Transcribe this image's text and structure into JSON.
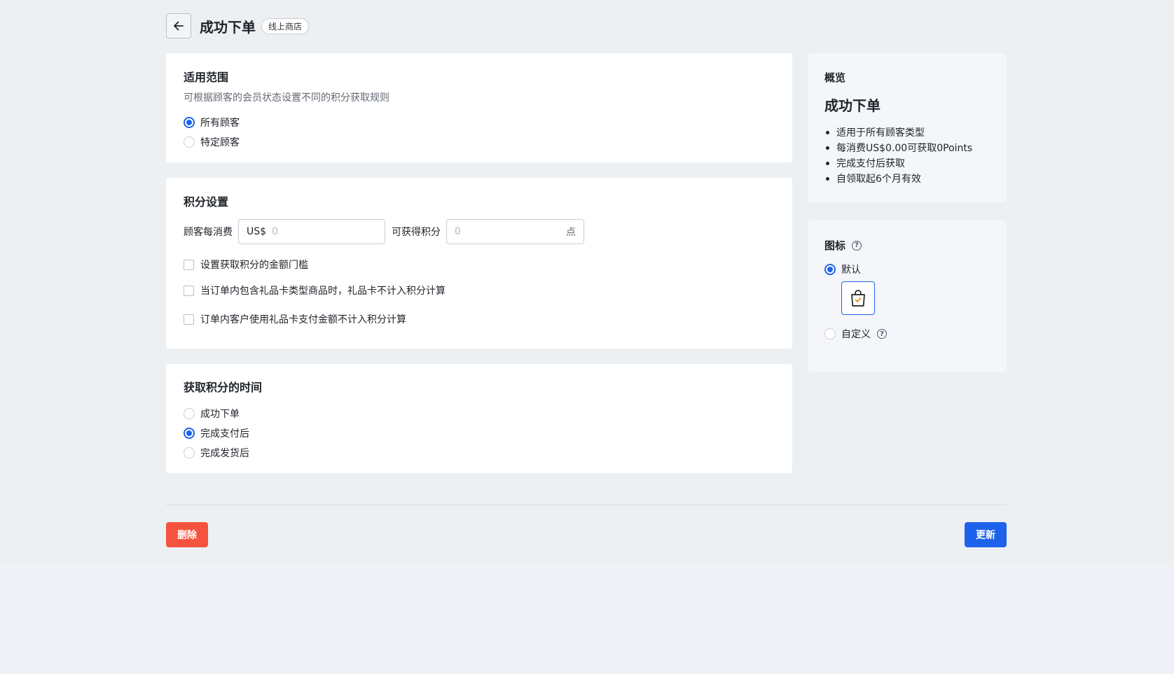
{
  "header": {
    "title": "成功下单",
    "tag": "线上商店"
  },
  "scope": {
    "title": "适用范围",
    "desc": "可根据顾客的会员状态设置不同的积分获取规则",
    "options": [
      "所有顾客",
      "特定顾客"
    ],
    "selected": 0
  },
  "points": {
    "title": "积分设置",
    "spend_label": "顾客每消费",
    "currency_prefix": "US$",
    "spend_placeholder": "0",
    "earn_label": "可获得积分",
    "earn_placeholder": "0",
    "earn_suffix": "点",
    "checks": [
      "设置获取积分的金额门槛",
      "当订单内包含礼品卡类型商品时，礼品卡不计入积分计算",
      "订单内客户使用礼品卡支付金额不计入积分计算"
    ]
  },
  "timing": {
    "title": "获取积分的时间",
    "options": [
      "成功下单",
      "完成支付后",
      "完成发货后"
    ],
    "selected": 1
  },
  "overview": {
    "title": "概览",
    "name": "成功下单",
    "items": [
      "适用于所有顾客类型",
      "每消费US$0.00可获取0Points",
      "完成支付后获取",
      "自领取起6个月有效"
    ]
  },
  "icon_section": {
    "title": "图标",
    "options": [
      "默认",
      "自定义"
    ],
    "selected": 0,
    "preview_icon": "shopping-bag-icon",
    "help_glyph": "?"
  },
  "footer": {
    "delete_label": "删除",
    "update_label": "更新"
  },
  "colors": {
    "primary": "#1e62ec",
    "danger": "#f5533d",
    "background": "#edf0f3"
  }
}
